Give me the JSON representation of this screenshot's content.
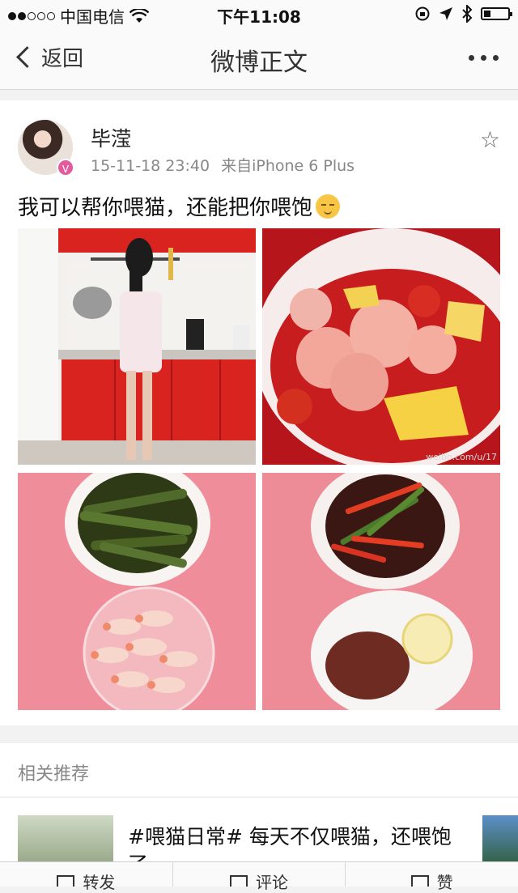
{
  "status_bar": {
    "carrier": "中国电信",
    "time": "下午11:08"
  },
  "nav": {
    "back_label": "返回",
    "title": "微博正文"
  },
  "post": {
    "author": "毕滢",
    "timestamp": "15-11-18 23:40",
    "source": "来自iPhone 6 Plus",
    "text": "我可以帮你喂猫，还能把你喂饱",
    "image_watermark": "weibo.com/u/17"
  },
  "related": {
    "header": "相关推荐",
    "item_text": "#喂猫日常# 每天不仅喂猫，还喂饱了"
  },
  "bottom_bar": {
    "repost": "转发",
    "comment": "评论",
    "like": "赞"
  },
  "colors": {
    "kitchen_red": "#d8231f",
    "tablecloth_pink": "#ef8e9a",
    "sauce_red": "#b5151b"
  }
}
